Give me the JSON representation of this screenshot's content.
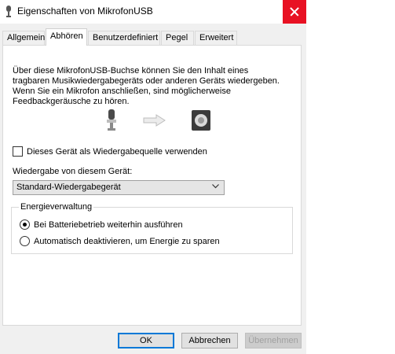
{
  "window": {
    "title": "Eigenschaften von MikrofonUSB",
    "icon": "microphone-icon",
    "close_icon": "close-icon"
  },
  "tabs": [
    {
      "label": "Allgemein",
      "active": false
    },
    {
      "label": "Abhören",
      "active": true
    },
    {
      "label": "Benutzerdefiniert",
      "active": false
    },
    {
      "label": "Pegel",
      "active": false
    },
    {
      "label": "Erweitert",
      "active": false
    }
  ],
  "description": "Über diese MikrofonUSB-Buchse können Sie den Inhalt eines tragbaren Musikwiedergabegeräts oder anderen Geräts wiedergeben. Wenn Sie ein Mikrofon anschließen, sind möglicherweise Feedbackgeräusche zu hören.",
  "illustration": {
    "source_icon": "microphone-icon",
    "arrow_icon": "arrow-right-icon",
    "target_icon": "speaker-icon"
  },
  "listen_checkbox": {
    "label": "Dieses Gerät als Wiedergabequelle verwenden",
    "checked": false
  },
  "playback": {
    "label": "Wiedergabe von diesem Gerät:",
    "selected": "Standard-Wiedergabegerät"
  },
  "power": {
    "legend": "Energieverwaltung",
    "options": [
      {
        "label": "Bei Batteriebetrieb weiterhin ausführen",
        "selected": true
      },
      {
        "label": "Automatisch deaktivieren, um Energie zu sparen",
        "selected": false
      }
    ]
  },
  "buttons": {
    "ok": "OK",
    "cancel": "Abbrechen",
    "apply": "Übernehmen"
  },
  "colors": {
    "close_bg": "#e81123",
    "focus": "#0078d7"
  }
}
